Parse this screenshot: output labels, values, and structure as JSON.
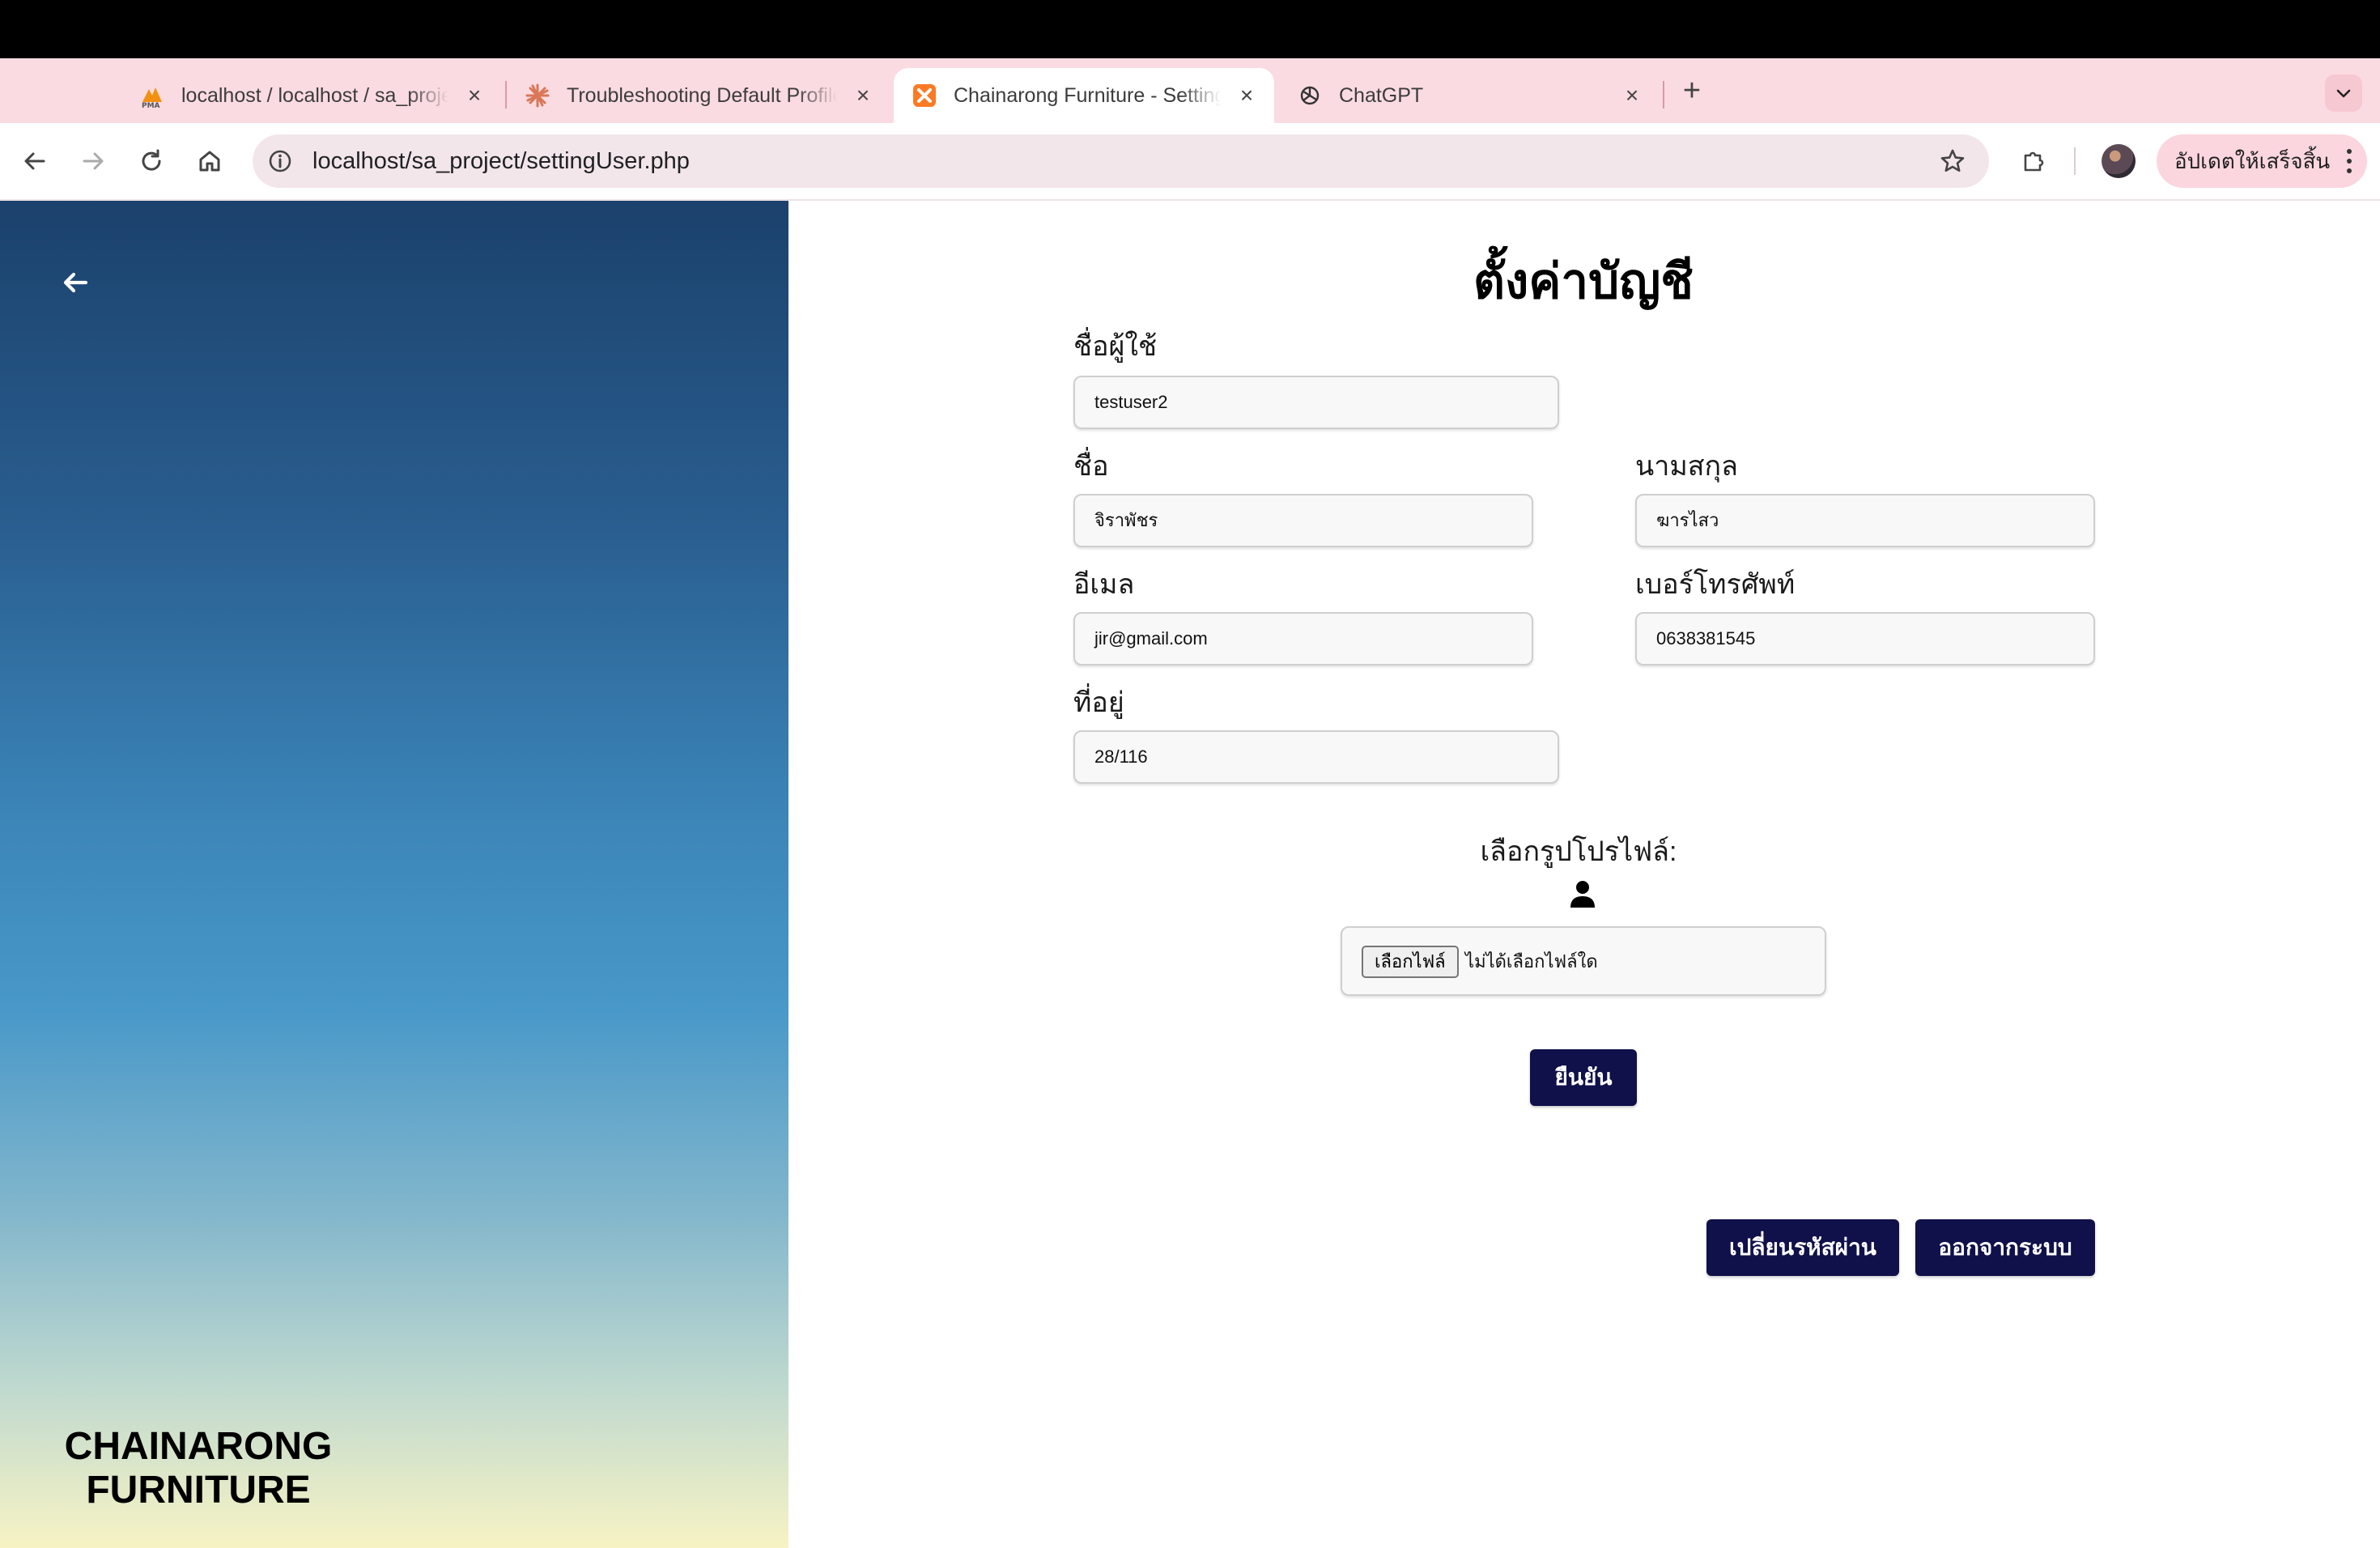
{
  "browser": {
    "tabs": [
      {
        "title": "localhost / localhost / sa_project",
        "favicon": "phpmyadmin-icon",
        "active": false
      },
      {
        "title": "Troubleshooting Default Profile",
        "favicon": "claude-icon",
        "active": false
      },
      {
        "title": "Chainarong Furniture - Settings",
        "favicon": "xampp-icon",
        "active": true
      },
      {
        "title": "ChatGPT",
        "favicon": "chatgpt-icon",
        "active": false
      }
    ],
    "url": "localhost/sa_project/settingUser.php",
    "update_button": "อัปเดตให้เสร็จสิ้น"
  },
  "sidebar": {
    "brand_line1": "CHAINARONG",
    "brand_line2": "FURNITURE"
  },
  "form": {
    "title": "ตั้งค่าบัญชี",
    "username": {
      "label": "ชื่อผู้ใช้",
      "value": "testuser2"
    },
    "first_name": {
      "label": "ชื่อ",
      "value": "จิราพัชร"
    },
    "last_name": {
      "label": "นามสกุล",
      "value": "ฆารไสว"
    },
    "email": {
      "label": "อีเมล",
      "value": "jir@gmail.com"
    },
    "phone": {
      "label": "เบอร์โทรศัพท์",
      "value": "0638381545"
    },
    "address": {
      "label": "ที่อยู่",
      "value": "28/116"
    },
    "profile_picture_label": "เลือกรูปโปรไฟล์:",
    "file_button": "เลือกไฟล์",
    "file_status": "ไม่ได้เลือกไฟล์ใด",
    "confirm_button": "ยืนยัน",
    "change_password_button": "เปลี่ยนรหัสผ่าน",
    "logout_button": "ออกจากระบบ"
  },
  "colors": {
    "tabstrip": "#fadbe1",
    "button_dark": "#10104a",
    "sidebar_top": "#1b416c",
    "sidebar_bottom": "#f7f3c4"
  }
}
